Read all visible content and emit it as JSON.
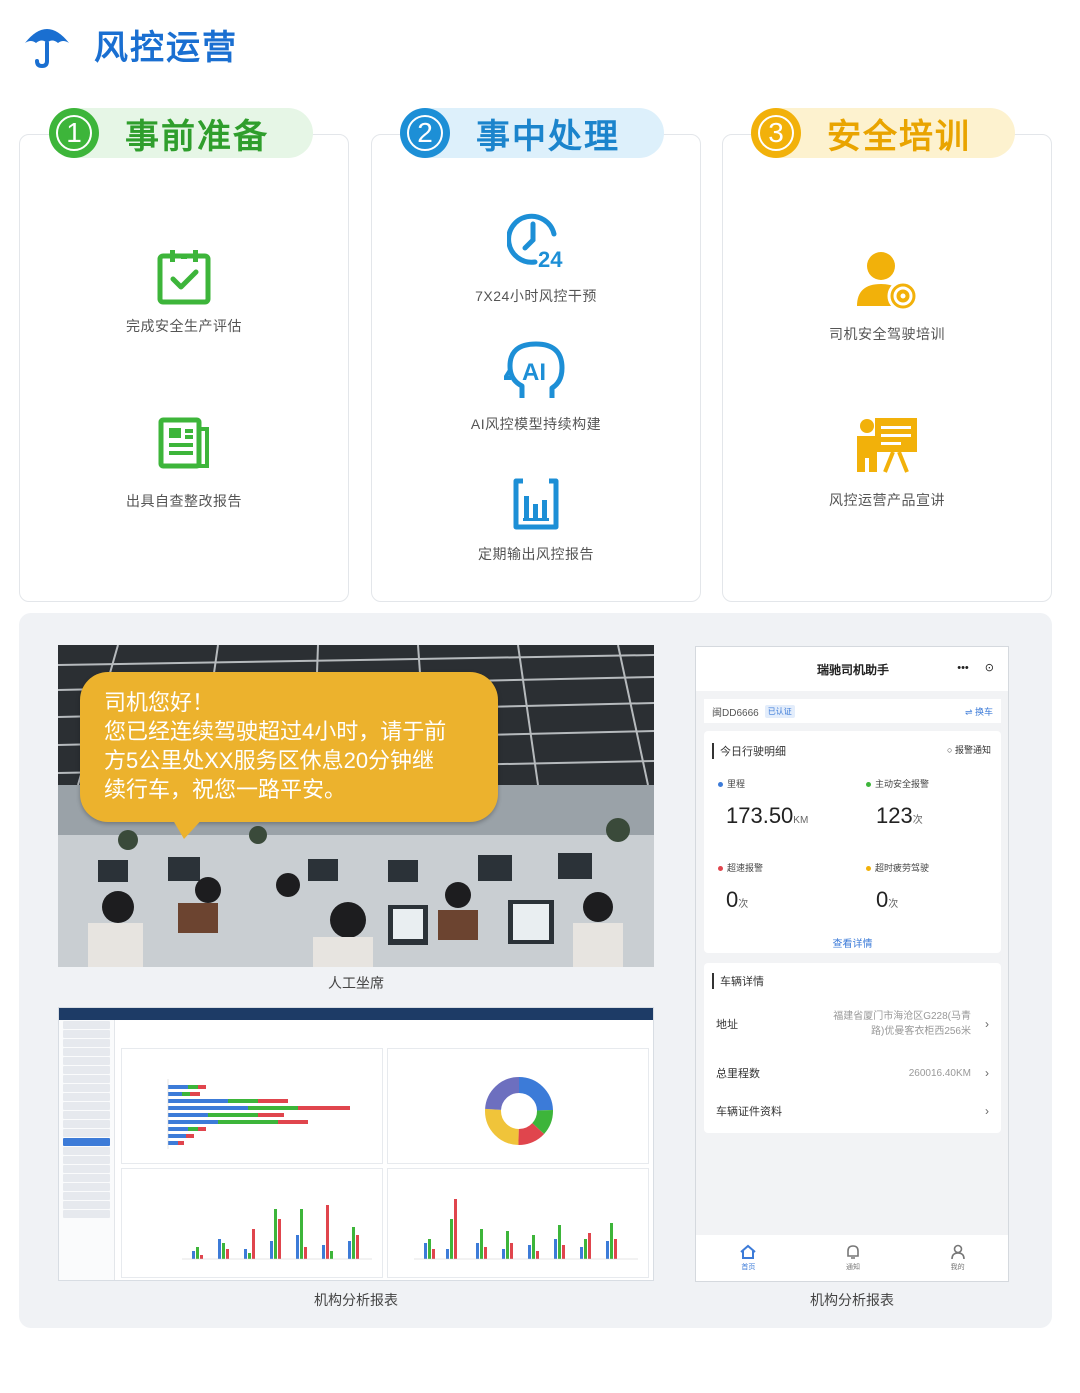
{
  "header": {
    "title": "风控运营",
    "icon": "umbrella-icon"
  },
  "stages": [
    {
      "num": "1",
      "title": "事前准备",
      "color": "#3db53a",
      "items": [
        {
          "label": "完成安全生产评估",
          "icon": "calendar-check-icon"
        },
        {
          "label": "出具自查整改报告",
          "icon": "report-document-icon"
        }
      ]
    },
    {
      "num": "2",
      "title": "事中处理",
      "color": "#1d8fd6",
      "items": [
        {
          "label": "7X24小时风控干预",
          "icon": "clock-24-icon"
        },
        {
          "label": "AI风控模型持续构建",
          "icon": "ai-head-icon"
        },
        {
          "label": "定期输出风控报告",
          "icon": "bar-report-icon"
        }
      ]
    },
    {
      "num": "3",
      "title": "安全培训",
      "color": "#f2b10a",
      "items": [
        {
          "label": "司机安全驾驶培训",
          "icon": "driver-wheel-icon"
        },
        {
          "label": "风控运营产品宣讲",
          "icon": "presenter-board-icon"
        }
      ]
    }
  ],
  "photo": {
    "bubble_line1": "司机您好！",
    "bubble_line2": "您已经连续驾驶超过4小时，请于前",
    "bubble_line3": "方5公里处XX服务区休息20分钟继",
    "bubble_line4": "续行车，祝您一路平安。",
    "caption": "人工坐席"
  },
  "dashboard": {
    "caption": "机构分析报表"
  },
  "phone": {
    "title": "瑞驰司机助手",
    "plate": "闽DD6666",
    "verified": "已认证",
    "switch": "⇌ 换车",
    "today_title": "今日行驶明细",
    "alarm_notice": "报警通知",
    "stats": [
      {
        "label": "里程",
        "value": "173.50",
        "unit": "KM",
        "color": "#3c7bd8"
      },
      {
        "label": "主动安全报警",
        "value": "123",
        "unit": "次",
        "color": "#3db53a"
      },
      {
        "label": "超速报警",
        "value": "0",
        "unit": "次",
        "color": "#e0454d"
      },
      {
        "label": "超时疲劳驾驶",
        "value": "0",
        "unit": "次",
        "color": "#f2b10a"
      }
    ],
    "details_link": "查看详情",
    "vehicle_title": "车辆详情",
    "rows": [
      {
        "label": "地址",
        "value_line1": "福建省厦门市海沧区G228(马青",
        "value_line2": "路)优曼客衣柜西256米"
      },
      {
        "label": "总里程数",
        "value_line1": "260016.40KM",
        "value_line2": ""
      },
      {
        "label": "车辆证件资料",
        "value_line1": "",
        "value_line2": ""
      }
    ],
    "tabs": [
      {
        "label": "首页",
        "icon": "home-icon"
      },
      {
        "label": "通知",
        "icon": "bell-icon"
      },
      {
        "label": "我的",
        "icon": "user-icon"
      }
    ],
    "caption": "机构分析报表"
  }
}
